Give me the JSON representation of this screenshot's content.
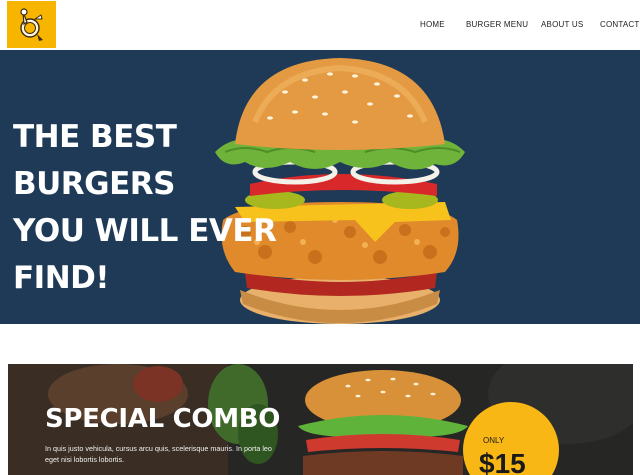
{
  "header": {
    "logo_icon": "burger-mascot-icon",
    "nav": [
      "HOME",
      "BURGER MENU",
      "ABOUT US",
      "CONTACT"
    ]
  },
  "hero": {
    "title_lines": [
      "THE BEST BURGERS",
      "YOU WILL EVER",
      "FIND!"
    ],
    "background_color": "#1e3a57"
  },
  "combo": {
    "title": "SPECIAL COMBO",
    "text": "In quis justo vehicula, cursus arcu quis, scelerisque mauris. In porta leo eget nisi lobortis lobortis.",
    "price_label": "ONLY",
    "price": "$15",
    "badge_color": "#f8b714"
  },
  "colors": {
    "accent": "#f7b500",
    "navy": "#1e3a57"
  }
}
